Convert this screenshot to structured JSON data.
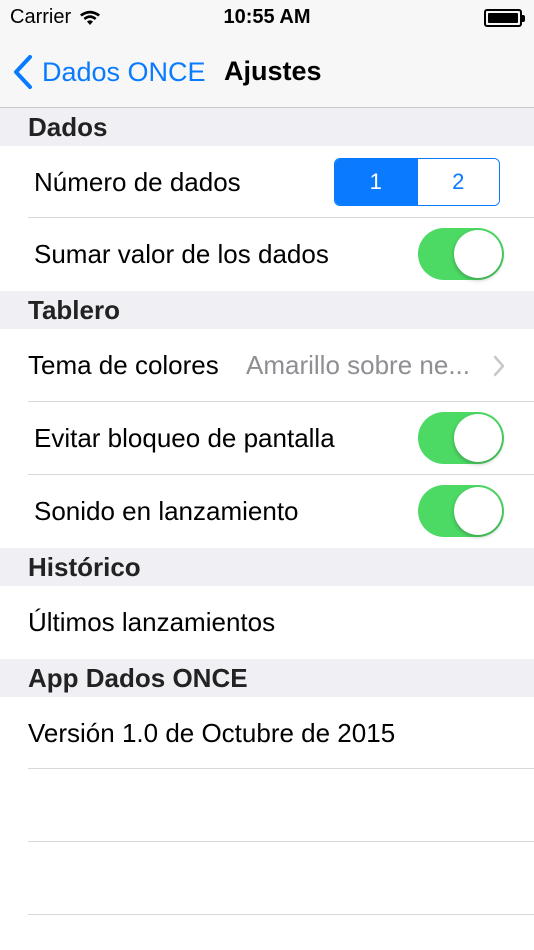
{
  "status_bar": {
    "carrier": "Carrier",
    "time": "10:55 AM"
  },
  "nav": {
    "back_label": "Dados ONCE",
    "title": "Ajustes"
  },
  "sections": {
    "dados": {
      "header": "Dados",
      "numero_label": "Número de dados",
      "segments": [
        "1",
        "2"
      ],
      "selected_segment": "1",
      "sumar_label": "Sumar valor de los dados",
      "sumar_on": true
    },
    "tablero": {
      "header": "Tablero",
      "tema_label": "Tema de colores",
      "tema_value": "Amarillo sobre ne...",
      "evitar_label": "Evitar bloqueo de pantalla",
      "evitar_on": true,
      "sonido_label": "Sonido en lanzamiento",
      "sonido_on": true
    },
    "historico": {
      "header": "Histórico",
      "ultimos_label": "Últimos lanzamientos"
    },
    "app": {
      "header": "App Dados ONCE",
      "version_label": "Versión 1.0 de Octubre de 2015"
    }
  },
  "colors": {
    "accent": "#0a7bff",
    "toggle_on": "#4cd964",
    "group_bg": "#efeff4"
  }
}
